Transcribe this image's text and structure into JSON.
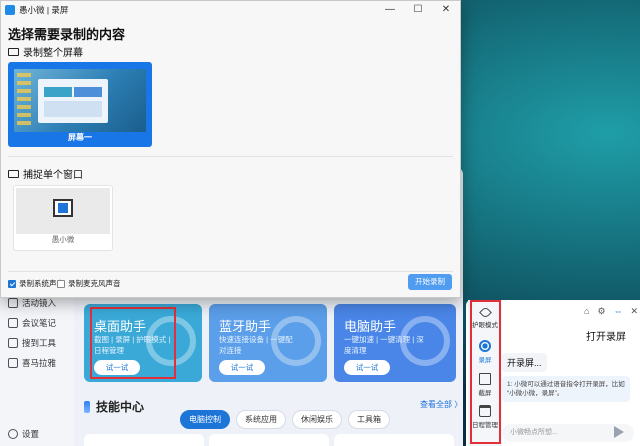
{
  "window": {
    "title": "愚小微 | 录屏",
    "minimize_glyph": "—",
    "maximize_glyph": "☐",
    "close_glyph": "✕"
  },
  "recorder": {
    "heading": "选择需要录制的内容",
    "full_screen_label": "录制整个屏幕",
    "screen_caption": "屏幕一",
    "single_window_label": "捕捉单个窗口",
    "window_caption": "愚小微",
    "options": {
      "system_audio": {
        "label": "录制系统声音",
        "checked": true
      },
      "microphone": {
        "label": "录制麦克风声音",
        "checked": false
      }
    },
    "start_button": "开始录制"
  },
  "background_app": {
    "sidebar": [
      {
        "label": "活动镜入",
        "icon": "camera-icon"
      },
      {
        "label": "会议笔记",
        "icon": "note-icon"
      },
      {
        "label": "搜到工具",
        "icon": "tool-icon"
      },
      {
        "label": "喜马拉雅",
        "icon": "audio-icon"
      },
      {
        "label": "设置",
        "icon": "gear-icon"
      }
    ],
    "cards": [
      {
        "title": "桌面助手",
        "desc": "截图 | 录屏 | 护眼模式 | 日程管理",
        "button": "试一试",
        "color": "#3aa9d8"
      },
      {
        "title": "蓝牙助手",
        "desc": "快速连接设备 | 一键配对连接",
        "button": "试一试",
        "color": "#5b9ee9"
      },
      {
        "title": "电脑助手",
        "desc": "一键加速 | 一键清理 | 深度清理",
        "button": "试一试",
        "color": "#4a86e8"
      }
    ],
    "tech_center": "技能中心",
    "view_all": "查看全部 〉",
    "tabs": [
      {
        "label": "电脑控制",
        "active": true
      },
      {
        "label": "系统应用",
        "active": false
      },
      {
        "label": "休闲娱乐",
        "active": false
      },
      {
        "label": "工具箱",
        "active": false
      }
    ]
  },
  "assistant": {
    "rail": [
      {
        "label": "护眼模式",
        "icon": "eye-icon"
      },
      {
        "label": "录屏",
        "icon": "record-icon"
      },
      {
        "label": "截屏",
        "icon": "crop-icon"
      },
      {
        "label": "日程管理",
        "icon": "calendar-icon"
      }
    ],
    "open_record": "打开录屏",
    "chip": "开录屏...",
    "tip": "1: 小微可以通过语音指令打开录屏，比如 “小微小微，录屏”。",
    "input_placeholder": "小微畅点所想...",
    "accent": "#1d75d8"
  },
  "highlight_color": "#e2303a"
}
